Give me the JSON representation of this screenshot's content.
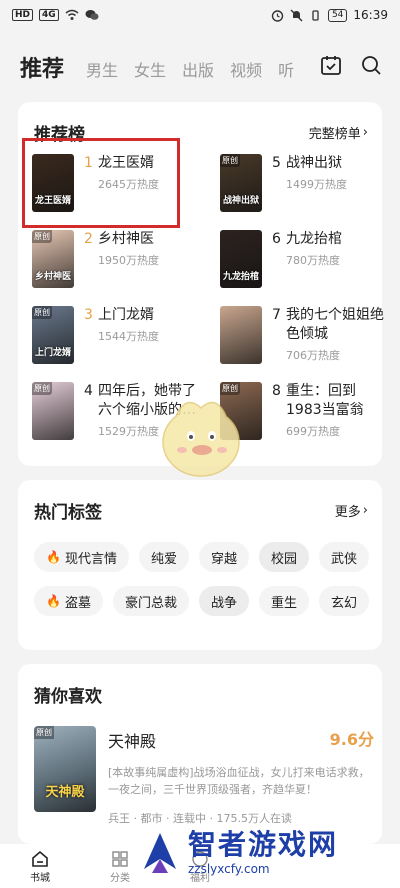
{
  "status": {
    "left_badges": [
      "HD",
      "4G"
    ],
    "battery": "54",
    "time": "16:39"
  },
  "nav": {
    "tabs": [
      "推荐",
      "男生",
      "女生",
      "出版",
      "视频",
      "听"
    ],
    "icons": [
      "calendar-check-icon",
      "search-icon"
    ]
  },
  "ranking": {
    "title": "推荐榜",
    "more": "完整榜单",
    "items": [
      {
        "rank": "1",
        "name": "龙王医婿",
        "heat": "2645万热度",
        "cover_text": "龙王医婿",
        "cover_badge": "",
        "color": "#3b2a1e"
      },
      {
        "rank": "5",
        "name": "战神出狱",
        "heat": "1499万热度",
        "cover_text": "战神出狱",
        "cover_badge": "原创",
        "color": "#4a3a2a"
      },
      {
        "rank": "2",
        "name": "乡村神医",
        "heat": "1950万热度",
        "cover_text": "乡村神医",
        "cover_badge": "原创",
        "color": "#e9c9b5"
      },
      {
        "rank": "6",
        "name": "九龙抬棺",
        "heat": "780万热度",
        "cover_text": "九龙抬棺",
        "cover_badge": "",
        "color": "#2d2320"
      },
      {
        "rank": "3",
        "name": "上门龙婿",
        "heat": "1544万热度",
        "cover_text": "上门龙婿",
        "cover_badge": "原创",
        "color": "#6b7a8e"
      },
      {
        "rank": "7",
        "name": "我的七个姐姐绝色倾城",
        "heat": "706万热度",
        "cover_text": "",
        "cover_badge": "",
        "color": "#c9a68e"
      },
      {
        "rank": "4",
        "name": "四年后，她带了六个缩小版的…",
        "heat": "1529万热度",
        "cover_text": "",
        "cover_badge": "原创",
        "color": "#e7cfd9"
      },
      {
        "rank": "8",
        "name": "重生：回到1983当富翁",
        "heat": "699万热度",
        "cover_text": "",
        "cover_badge": "原创",
        "color": "#8e6a52"
      }
    ]
  },
  "tags": {
    "title": "热门标签",
    "more": "更多",
    "row1": [
      {
        "label": "现代言情",
        "hot": true,
        "dark": false
      },
      {
        "label": "纯爱",
        "hot": false,
        "dark": false
      },
      {
        "label": "穿越",
        "hot": false,
        "dark": false
      },
      {
        "label": "校园",
        "hot": false,
        "dark": true
      },
      {
        "label": "武侠",
        "hot": false,
        "dark": false
      }
    ],
    "row2": [
      {
        "label": "盗墓",
        "hot": true,
        "dark": false
      },
      {
        "label": "豪门总裁",
        "hot": false,
        "dark": false
      },
      {
        "label": "战争",
        "hot": false,
        "dark": true
      },
      {
        "label": "重生",
        "hot": false,
        "dark": false
      },
      {
        "label": "玄幻",
        "hot": false,
        "dark": false
      }
    ]
  },
  "guess": {
    "title": "猜你喜欢",
    "book": {
      "title": "天神殿",
      "score": "9.6分",
      "cover_text": "天神殿",
      "cover_badge": "原创",
      "desc": "[本故事纯属虚构]战场浴血征战，女儿打来电话求救，一夜之间，三千世界顶级强者，齐趋华夏！",
      "meta": "兵王 · 都市 · 连载中 · 175.5万人在读"
    }
  },
  "bottom": {
    "items": [
      "书城",
      "分类",
      "福利"
    ]
  },
  "watermark": {
    "big": "智者游戏网",
    "small": "zzslyxcfy.com"
  }
}
